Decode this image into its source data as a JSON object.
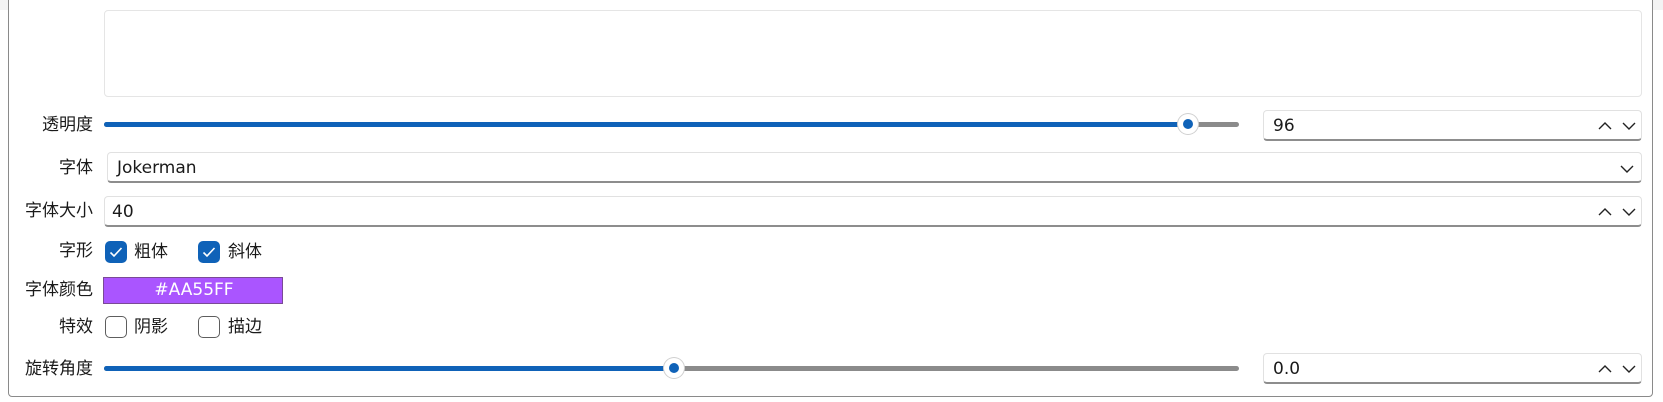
{
  "text_area": {
    "value": ""
  },
  "opacity": {
    "label": "透明度",
    "value": "96",
    "fraction": 0.955
  },
  "font": {
    "label": "字体",
    "selected": "Jokerman"
  },
  "font_size": {
    "label": "字体大小",
    "value": "40"
  },
  "font_style": {
    "label": "字形",
    "bold": {
      "label": "粗体",
      "checked": true
    },
    "italic": {
      "label": "斜体",
      "checked": true
    }
  },
  "font_color": {
    "label": "字体颜色",
    "value": "#AA55FF",
    "swatch_color": "#AA55FF"
  },
  "effects": {
    "label": "特效",
    "shadow": {
      "label": "阴影",
      "checked": false
    },
    "outline": {
      "label": "描边",
      "checked": false
    }
  },
  "rotation": {
    "label": "旋转角度",
    "value": "0.0",
    "fraction": 0.502
  },
  "colors": {
    "accent": "#0F62B8",
    "track": "#8B8B8B"
  }
}
